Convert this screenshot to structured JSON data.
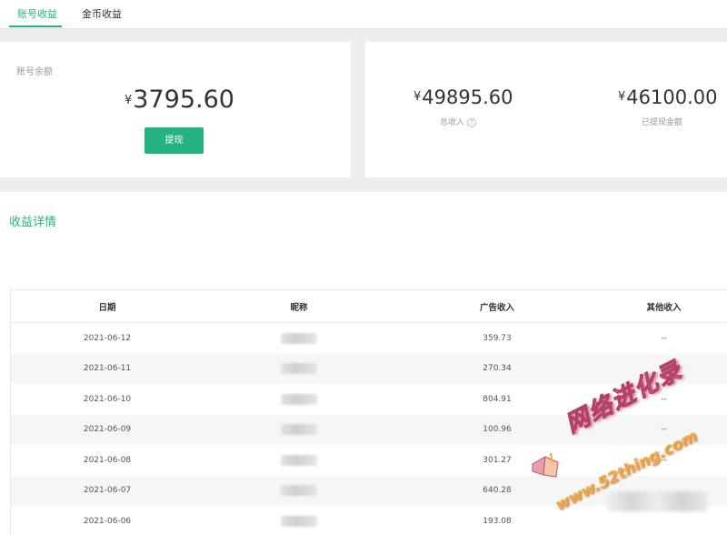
{
  "tabs": [
    {
      "label": "账号收益",
      "active": true
    },
    {
      "label": "金币收益",
      "active": false
    }
  ],
  "balance": {
    "label": "账号余额",
    "currency": "¥",
    "amount": "3795.60",
    "withdraw_button": "提现"
  },
  "stats": {
    "total_income": {
      "currency": "¥",
      "amount": "49895.60",
      "label": "总收入",
      "help_icon": "question-circle-icon"
    },
    "withdrawn": {
      "currency": "¥",
      "amount": "46100.00",
      "label": "已提现金额"
    }
  },
  "detail": {
    "title": "收益详情",
    "columns": [
      "日期",
      "昵称",
      "广告收入",
      "其他收入"
    ],
    "rows": [
      {
        "date": "2021-06-12",
        "nickname": "",
        "ad_income": "359.73",
        "other_income": "--"
      },
      {
        "date": "2021-06-11",
        "nickname": "",
        "ad_income": "270.34",
        "other_income": "--"
      },
      {
        "date": "2021-06-10",
        "nickname": "",
        "ad_income": "804.91",
        "other_income": "--"
      },
      {
        "date": "2021-06-09",
        "nickname": "",
        "ad_income": "100.96",
        "other_income": "--"
      },
      {
        "date": "2021-06-08",
        "nickname": "",
        "ad_income": "301.27",
        "other_income": "--"
      },
      {
        "date": "2021-06-07",
        "nickname": "",
        "ad_income": "640.28",
        "other_income": ""
      },
      {
        "date": "2021-06-06",
        "nickname": "",
        "ad_income": "193.08",
        "other_income": ""
      }
    ]
  },
  "watermark": {
    "text_cn": "网络进化录",
    "url": "www.52thing.com"
  },
  "colors": {
    "accent": "#23b383",
    "background": "#eeeeee"
  }
}
